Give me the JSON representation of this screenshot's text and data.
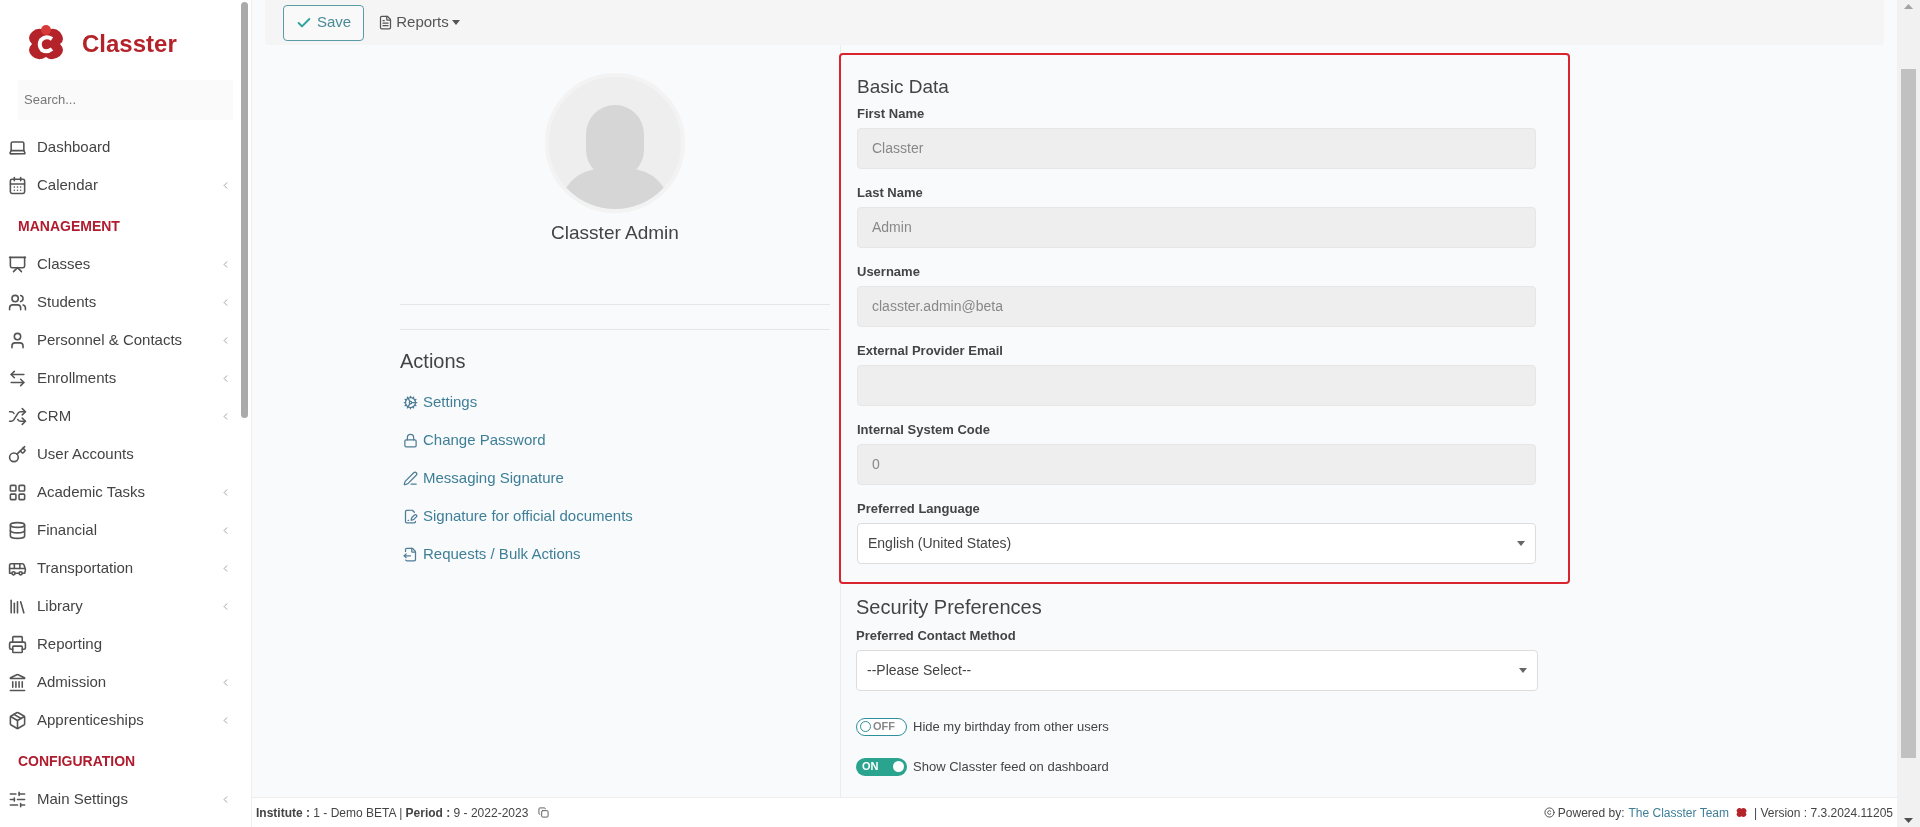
{
  "sidebar": {
    "logo_text": "Classter",
    "search": {
      "placeholder": "Search..."
    },
    "items": [
      {
        "kind": "item",
        "label": "Dashboard",
        "submenu": false
      },
      {
        "kind": "item",
        "label": "Calendar",
        "submenu": true
      },
      {
        "kind": "header",
        "label": "MANAGEMENT"
      },
      {
        "kind": "item",
        "label": "Classes",
        "submenu": true
      },
      {
        "kind": "item",
        "label": "Students",
        "submenu": true
      },
      {
        "kind": "item",
        "label": "Personnel & Contacts",
        "submenu": true
      },
      {
        "kind": "item",
        "label": "Enrollments",
        "submenu": true
      },
      {
        "kind": "item",
        "label": "CRM",
        "submenu": true
      },
      {
        "kind": "item",
        "label": "User Accounts",
        "submenu": false
      },
      {
        "kind": "item",
        "label": "Academic Tasks",
        "submenu": true
      },
      {
        "kind": "item",
        "label": "Financial",
        "submenu": true
      },
      {
        "kind": "item",
        "label": "Transportation",
        "submenu": true
      },
      {
        "kind": "item",
        "label": "Library",
        "submenu": true
      },
      {
        "kind": "item",
        "label": "Reporting",
        "submenu": false
      },
      {
        "kind": "item",
        "label": "Admission",
        "submenu": true
      },
      {
        "kind": "item",
        "label": "Apprenticeships",
        "submenu": true
      },
      {
        "kind": "header",
        "label": "CONFIGURATION"
      },
      {
        "kind": "item",
        "label": "Main Settings",
        "submenu": true
      }
    ]
  },
  "toolbar": {
    "save": "Save",
    "reports": "Reports"
  },
  "profile": {
    "name": "Classter Admin",
    "actions_title": "Actions",
    "actions": [
      "Settings",
      "Change Password",
      "Messaging Signature",
      "Signature for official documents",
      "Requests / Bulk Actions"
    ]
  },
  "basic_data": {
    "title": "Basic Data",
    "highlighted": true,
    "fields": [
      {
        "kind": "input",
        "label": "First Name",
        "value": "Classter",
        "disabled": true
      },
      {
        "kind": "input",
        "label": "Last Name",
        "value": "Admin",
        "disabled": true
      },
      {
        "kind": "input",
        "label": "Username",
        "value": "classter.admin@beta",
        "disabled": true
      },
      {
        "kind": "input",
        "label": "External Provider Email",
        "disabled": true
      },
      {
        "kind": "input",
        "label": "Internal System Code",
        "value": "0",
        "disabled": true
      },
      {
        "kind": "select",
        "label": "Preferred Language",
        "value": "English (United States)"
      }
    ]
  },
  "security": {
    "title": "Security Preferences",
    "fields": [
      {
        "kind": "select",
        "label": "Preferred Contact Method",
        "value": "--Please Select--"
      }
    ],
    "toggles": [
      {
        "state_text": "OFF",
        "on": false,
        "label": "Hide my birthday from other users"
      },
      {
        "state_text": "ON",
        "on": true,
        "label": "Show Classter feed on dashboard"
      }
    ]
  },
  "footer": {
    "context": "**Institute :** 1 - Demo BETA | **Period :** 9 - 2022-2023",
    "powered_by": "Powered by:",
    "team_link": "The Classter Team",
    "version": "| Version : 7.3.2024.11205"
  }
}
